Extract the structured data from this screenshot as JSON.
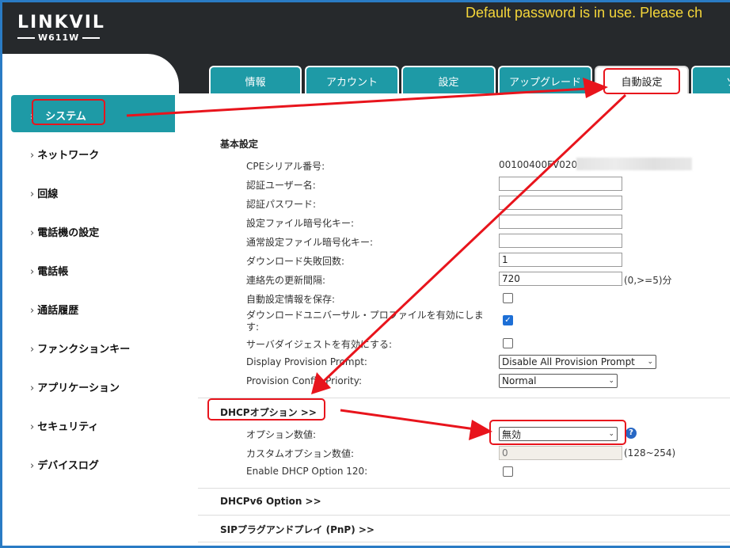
{
  "header": {
    "logo": "LINKVIL",
    "model": "W611W",
    "warning": "Default password is in use. Please ch"
  },
  "tabs": [
    {
      "label": "情報"
    },
    {
      "label": "アカウント"
    },
    {
      "label": "設定"
    },
    {
      "label": "アップグレード"
    },
    {
      "label": "自動設定"
    },
    {
      "label": "ソ"
    }
  ],
  "sidebar": {
    "items": [
      {
        "label": "システム"
      },
      {
        "label": "ネットワーク"
      },
      {
        "label": "回線"
      },
      {
        "label": "電話機の設定"
      },
      {
        "label": "電話帳"
      },
      {
        "label": "通話履歴"
      },
      {
        "label": "ファンクションキー"
      },
      {
        "label": "アプリケーション"
      },
      {
        "label": "セキュリティ"
      },
      {
        "label": "デバイスログ"
      }
    ],
    "chevron": "›"
  },
  "basic": {
    "title": "基本設定",
    "cpe_label": "CPEシリアル番号:",
    "cpe_value": "00100400FV020",
    "user_label": "認証ユーザー名:",
    "user_value": "",
    "pass_label": "認証パスワード:",
    "pass_value": "",
    "enc_label": "設定ファイル暗号化キー:",
    "enc_value": "",
    "common_enc_label": "通常設定ファイル暗号化キー:",
    "common_enc_value": "",
    "fail_label": "ダウンロード失敗回数:",
    "fail_value": "1",
    "interval_label": "連絡先の更新間隔:",
    "interval_value": "720",
    "interval_suffix": "(0,>=5)分",
    "save_label": "自動設定情報を保存:",
    "save_checked": false,
    "universal_label_1": "ダウンロードユニバーサル・プロファイルを有効にしま",
    "universal_label_2": "す:",
    "universal_checked": true,
    "digest_label": "サーバダイジェストを有効にする:",
    "digest_checked": false,
    "prompt_label": "Display Provision Prompt:",
    "prompt_value": "Disable All Provision Prompt",
    "priority_label": "Provision Config Priority:",
    "priority_value": "Normal"
  },
  "dhcp": {
    "title": "DHCPオプション >>",
    "option_label": "オプション数値:",
    "option_value": "無効",
    "custom_label": "カスタムオプション数値:",
    "custom_placeholder": "0",
    "custom_suffix": "(128~254)",
    "opt120_label": "Enable DHCP Option 120:",
    "opt120_checked": false,
    "help": "?"
  },
  "sections": {
    "dhcpv6": "DHCPv6 Option >>",
    "pnp": "SIPプラグアンドプレイ (PnP) >>"
  },
  "colors": {
    "header_bg": "#26292c",
    "accent": "#1e9aa6",
    "warning": "#f5d63a",
    "highlight": "#e8141c",
    "checkbox": "#1d6fd6"
  },
  "icons": {
    "select_arrow": "⌄",
    "check": "✓"
  }
}
